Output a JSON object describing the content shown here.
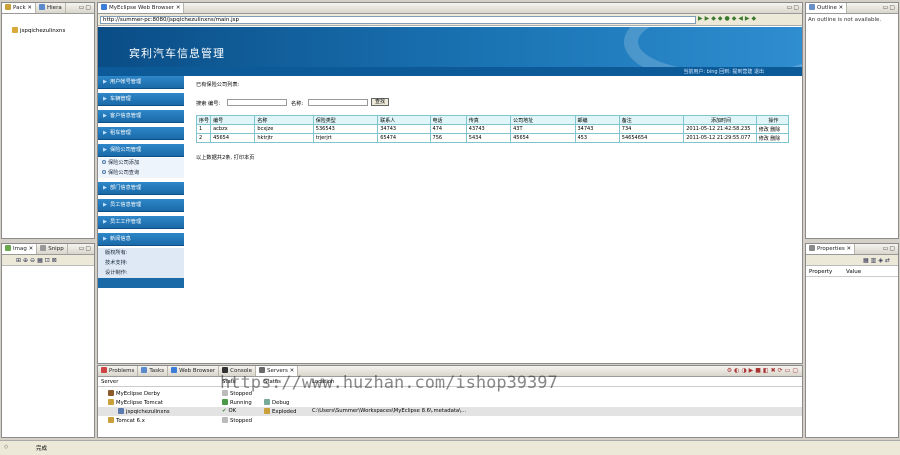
{
  "left_top": {
    "tabs": [
      "Pack",
      "Hiera"
    ],
    "tree_item": "jspqichezulinxns"
  },
  "left_bottom": {
    "tabs": [
      "Imag",
      "Snipp"
    ]
  },
  "browser": {
    "tab": "MyEclipse Web Browser",
    "url": "http://summer-pc:8080/jspqichezulinxns/main.jsp",
    "banner_title": "宾利汽车信息管理",
    "subnav": "当前用户: bing  回到: 提到营建  退出",
    "menu": [
      "用户帐号管理",
      "车辆管理",
      "客户信息管理",
      "租车管理",
      "保险公司管理",
      "部门信息管理",
      "员工信息管理",
      "员工工作管理",
      "新闻信息"
    ],
    "submenu": [
      "保险公司添加",
      "保险公司查询"
    ],
    "info": [
      "版权所有:",
      "技术支持:",
      "设计制作:"
    ],
    "content": {
      "heading": "已有保险公司列表:",
      "search_label1": "搜索 编号:",
      "search_label2": "名称:",
      "search_button": "查找",
      "columns": [
        "序号",
        "编号",
        "名称",
        "保险类型",
        "联系人",
        "电话",
        "传真",
        "公司地址",
        "邮编",
        "备注",
        "添加时间",
        "操作"
      ],
      "rows": [
        [
          "1",
          "acbzx",
          "bcxjze",
          "536543",
          "34743",
          "474",
          "43743",
          "43T",
          "34743",
          "734",
          "2011-05-12 21:42:58.235",
          "修改 删除"
        ],
        [
          "2",
          "45654",
          "hktrjtr",
          "trjerjrt",
          "65474",
          "756",
          "5434",
          "45654",
          "453",
          "54654654",
          "2011-05-12 21:29:55.077",
          "修改 删除"
        ]
      ],
      "footer": "以上数据共2条, 打印本页"
    }
  },
  "outline": {
    "tab": "Outline",
    "message": "An outline is not available."
  },
  "properties": {
    "tab": "Properties",
    "col1": "Property",
    "col2": "Value"
  },
  "console": {
    "tabs": [
      "Problems",
      "Tasks",
      "Web Browser",
      "Console",
      "Servers"
    ],
    "headers": [
      "Server",
      "State",
      "Status",
      "Location"
    ],
    "servers": [
      {
        "name": "MyEclipse Derby",
        "state": "Stopped",
        "status": "",
        "location": ""
      },
      {
        "name": "MyEclipse Tomcat",
        "state": "Running",
        "status": "Debug",
        "location": ""
      },
      {
        "name": "jspqichezulinxns",
        "state": "OK",
        "status": "Exploded",
        "location": "C:\\Users\\Summer\\Workspaces\\MyEclipse 8.6\\.metadata\\..."
      },
      {
        "name": "Tomcat 6.x",
        "state": "Stopped",
        "status": "",
        "location": ""
      }
    ]
  },
  "watermark": "https://www.huzhan.com/ishop39397",
  "status": {
    "text": "完成"
  }
}
